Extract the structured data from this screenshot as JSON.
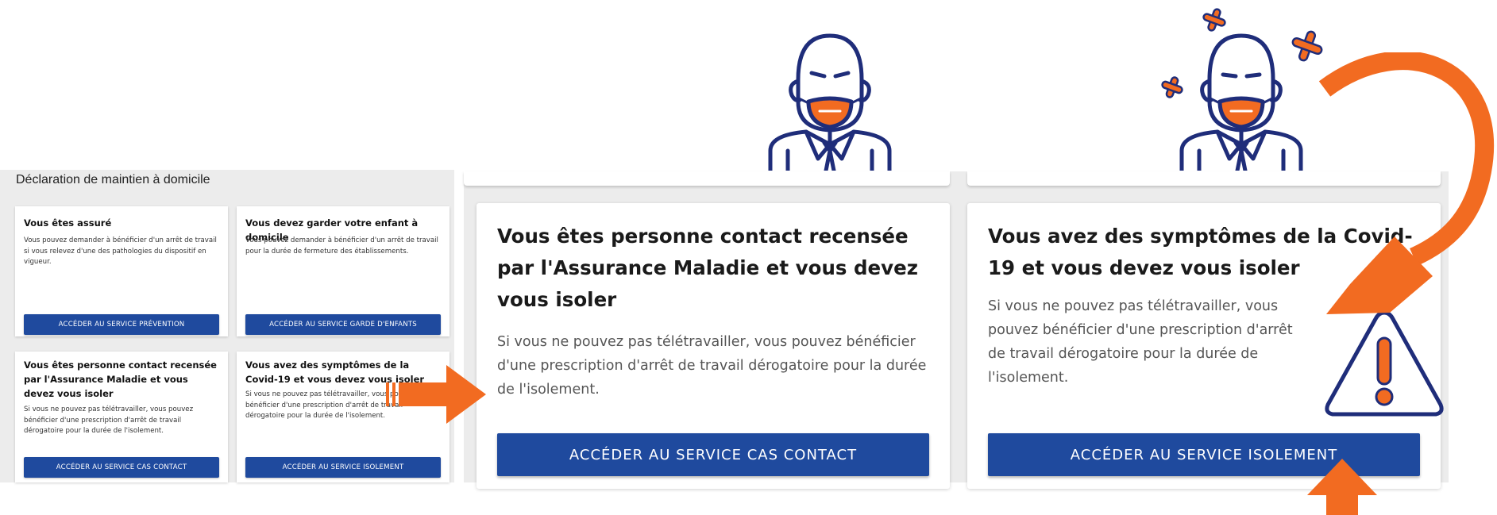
{
  "overview": {
    "title": "Déclaration de maintien à domicile",
    "cards": [
      {
        "title": "Vous êtes assuré",
        "text": "Vous pouvez demander à bénéficier d'un arrêt de travail si vous relevez d'une des pathologies du dispositif en vigueur.",
        "button": "ACCÉDER AU SERVICE PRÉVENTION"
      },
      {
        "title": "Vous devez garder votre enfant à domicile",
        "text": "Vous pouvez demander à bénéficier d'un arrêt de travail pour la durée de fermeture des établissements.",
        "button": "ACCÉDER AU SERVICE GARDE D'ENFANTS"
      },
      {
        "title": "Vous êtes personne contact recensée par l'Assurance Maladie et vous devez vous isoler",
        "text": "Si vous ne pouvez pas télétravailler, vous pouvez bénéficier d'une prescription d'arrêt de travail dérogatoire pour la durée de l'isolement.",
        "button": "ACCÉDER AU SERVICE CAS CONTACT"
      },
      {
        "title": "Vous avez des symptômes de la Covid-19 et vous devez vous isoler",
        "text": "Si vous ne pouvez pas télétravailler, vous pouvez bénéficier d'une prescription d'arrêt de travail dérogatoire pour la durée de l'isolement.",
        "button": "ACCÉDER AU SERVICE ISOLEMENT"
      }
    ]
  },
  "zoom": {
    "contact": {
      "title": "Vous êtes personne contact recensée par l'Assurance Maladie et vous devez vous isoler",
      "text": "Si vous ne pouvez pas télétravailler, vous pouvez bénéficier d'une prescription d'arrêt de travail dérogatoire pour la durée de l'isolement.",
      "button": "ACCÉDER AU SERVICE CAS CONTACT"
    },
    "isolement": {
      "title": "Vous avez des symptômes de la Covid-19 et vous devez vous isoler",
      "text": "Si vous ne pouvez pas télétravailler, vous pouvez bénéficier d'une prescription d'arrêt de travail dérogatoire pour la durée de l'isolement.",
      "button": "ACCÉDER AU SERVICE ISOLEMENT"
    }
  },
  "icons": {
    "person_masked": "masked-person-icon",
    "person_sick": "sick-masked-person-icon",
    "virus": "virus-icon",
    "warning": "warning-icon",
    "arrow": "arrow-icon"
  },
  "colors": {
    "primary_button": "#1f4a9e",
    "accent_orange": "#f26b21",
    "illustration_navy": "#1f2d7a",
    "panel_bg": "#ececec"
  }
}
